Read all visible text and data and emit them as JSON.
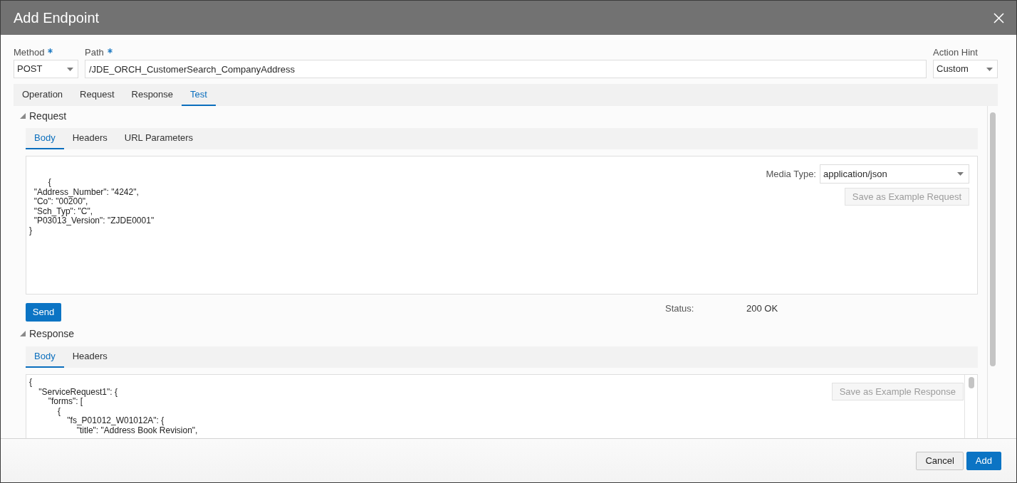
{
  "dialog": {
    "title": "Add Endpoint"
  },
  "fields": [
    {
      "label": "Method",
      "required": true,
      "kind": "select",
      "value": "POST"
    },
    {
      "label": "Path",
      "required": true,
      "kind": "text",
      "value": "/JDE_ORCH_CustomerSearch_CompanyAddress"
    },
    {
      "label": "Action Hint",
      "required": false,
      "kind": "select",
      "value": "Custom"
    }
  ],
  "tabs": [
    {
      "label": "Operation",
      "selected": false
    },
    {
      "label": "Request",
      "selected": false
    },
    {
      "label": "Response",
      "selected": false
    },
    {
      "label": "Test",
      "selected": true
    }
  ],
  "request": {
    "heading": "Request",
    "expanded": true,
    "tabs": [
      {
        "label": "Body",
        "selected": true
      },
      {
        "label": "Headers",
        "selected": false
      },
      {
        "label": "URL Parameters",
        "selected": false
      }
    ],
    "body": "        {\n  \"Address_Number\": \"4242\",\n  \"Co\": \"00200\",\n  \"Sch_Typ\": \"C\",\n  \"P03013_Version\": \"ZJDE0001\"\n}",
    "media_type_label": "Media Type:",
    "media_type": "application/json",
    "save_button": {
      "label": "Save as Example Request",
      "disabled": true
    }
  },
  "send_button": {
    "label": "Send"
  },
  "status": {
    "label": "Status:",
    "value": "200 OK"
  },
  "response": {
    "heading": "Response",
    "expanded": true,
    "tabs": [
      {
        "label": "Body",
        "selected": true
      },
      {
        "label": "Headers",
        "selected": false
      }
    ],
    "body": "{\n    \"ServiceRequest1\": {\n        \"forms\": [\n            {\n                \"fs_P01012_W01012A\": {\n                    \"title\": \"Address Book Revision\",",
    "save_button": {
      "label": "Save as Example Response",
      "disabled": true
    }
  },
  "buttons": [
    {
      "label": "Cancel",
      "kind": "secondary"
    },
    {
      "label": "Add",
      "kind": "primary"
    }
  ]
}
